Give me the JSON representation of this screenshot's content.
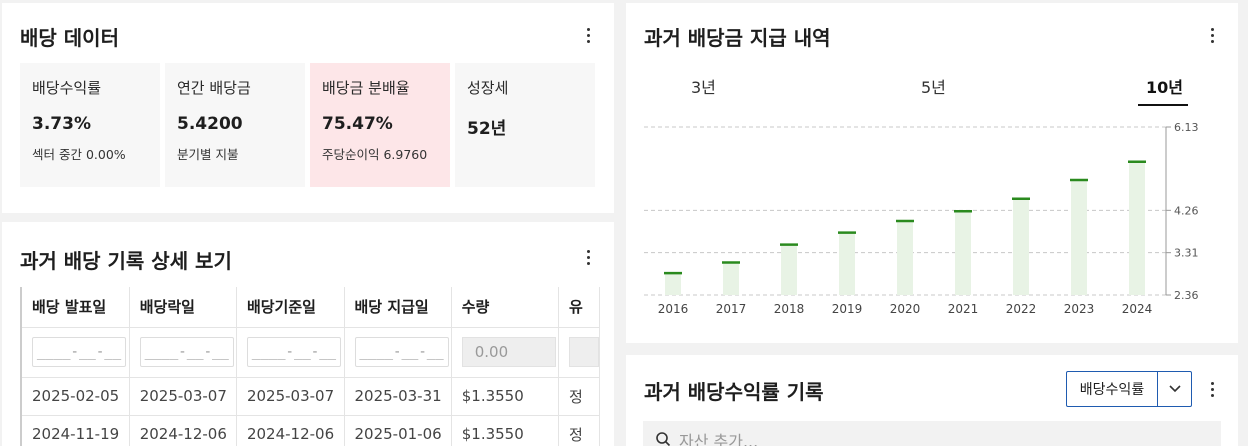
{
  "dividend_data": {
    "title": "배당 데이터",
    "cards": [
      {
        "label": "배당수익률",
        "value": "3.73%",
        "sub": "섹터 중간 0.00%"
      },
      {
        "label": "연간 배당금",
        "value": "5.4200",
        "sub": "분기별 지불"
      },
      {
        "label": "배당금 분배율",
        "value": "75.47%",
        "sub": "주당순이익 6.9760"
      },
      {
        "label": "성장세",
        "value": "52년",
        "sub": ""
      }
    ]
  },
  "history_table": {
    "title": "과거 배당 기록 상세 보기",
    "columns": [
      "배당 발표일",
      "배당락일",
      "배당기준일",
      "배당 지급일",
      "수량",
      "유"
    ],
    "filter_placeholder": "____-__-__",
    "qty_placeholder": "0.00",
    "rows": [
      [
        "2025-02-05",
        "2025-03-07",
        "2025-03-07",
        "2025-03-31",
        "$1.3550",
        "정"
      ],
      [
        "2024-11-19",
        "2024-12-06",
        "2024-12-06",
        "2025-01-06",
        "$1.3550",
        "정"
      ]
    ]
  },
  "payout_history": {
    "title": "과거 배당금 지급 내역",
    "tabs": [
      "3년",
      "5년",
      "10년"
    ],
    "active_tab": "10년"
  },
  "yield_history": {
    "title": "과거 배당수익률 기록",
    "selector_value": "배당수익률",
    "search_placeholder": "자산 추가..."
  },
  "chart_data": {
    "type": "bar",
    "categories": [
      "2016",
      "2017",
      "2018",
      "2019",
      "2020",
      "2021",
      "2022",
      "2023",
      "2024"
    ],
    "values": [
      2.85,
      3.09,
      3.49,
      3.76,
      4.02,
      4.24,
      4.52,
      4.94,
      5.35
    ],
    "y_ticks": [
      2.36,
      3.31,
      4.26,
      6.13
    ],
    "ylim": [
      2.36,
      6.13
    ],
    "grid": true,
    "bar_color": "#e8f3e5",
    "cap_color": "#2a8a1e"
  }
}
